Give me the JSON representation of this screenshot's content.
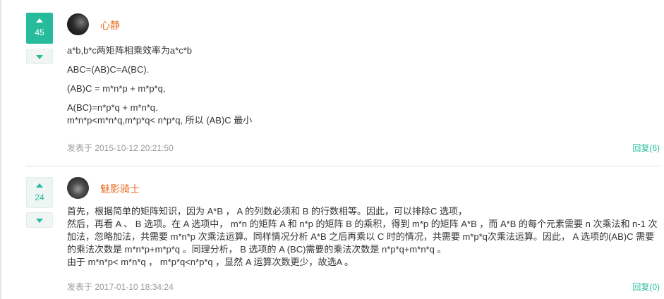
{
  "comments": [
    {
      "votes": "45",
      "username": "心静",
      "lines": [
        "a*b,b*c两矩阵相乘效率为a*c*b",
        "ABC=(AB)C=A(BC).",
        "(AB)C = m*n*p + m*p*q,",
        "A(BC)=n*p*q + m*n*q.",
        "m*n*p<m*n*q,m*p*q< n*p*q, 所以 (AB)C 最小"
      ],
      "timestamp": "发表于 2015-10-12 20:21:50",
      "reply_label": "回复(6)"
    },
    {
      "votes": "24",
      "username": "魅影骑士",
      "lines": [
        "首先，根据简单的矩阵知识，因为 A*B ， A 的列数必须和 B 的行数相等。因此，可以排除C 选项，",
        "然后，再看 A 、 B 选项。在 A 选项中， m*n 的矩阵 A 和 n*p 的矩阵 B 的乘积，得到 m*p 的矩阵 A*B ，而 A*B 的每个元素需要 n 次乘法和 n-1 次加法，忽略加法，共需要 m*n*p 次乘法运算。同样情况分析 A*B 之后再乘以 C 时的情况，共需要 m*p*q次乘法运算。因此， A 选项的(AB)C 需要的乘法次数是 m*n*p+m*p*q 。同理分析， B 选项的 A (BC)需要的乘法次数是 n*p*q+m*n*q 。",
        "由于 m*n*p< m*n*q ， m*p*q<n*p*q ，显然 A 运算次数更少，故选A 。"
      ],
      "timestamp": "发表于 2017-01-10 18:34:24",
      "reply_label": "回复(0)"
    }
  ]
}
